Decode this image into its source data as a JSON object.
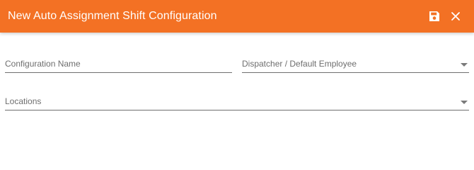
{
  "dialog": {
    "title": "New Auto Assignment Shift Configuration",
    "accent_color": "#f37124",
    "actions": [
      {
        "name": "save",
        "icon": "floppy-disk-icon"
      },
      {
        "name": "close",
        "icon": "close-icon"
      }
    ]
  },
  "form": {
    "configuration_name": {
      "label": "Configuration Name",
      "value": ""
    },
    "dispatcher": {
      "label": "Dispatcher / Default Employee",
      "value": "",
      "type": "dropdown"
    },
    "locations": {
      "label": "Locations",
      "value": "",
      "type": "dropdown"
    }
  }
}
